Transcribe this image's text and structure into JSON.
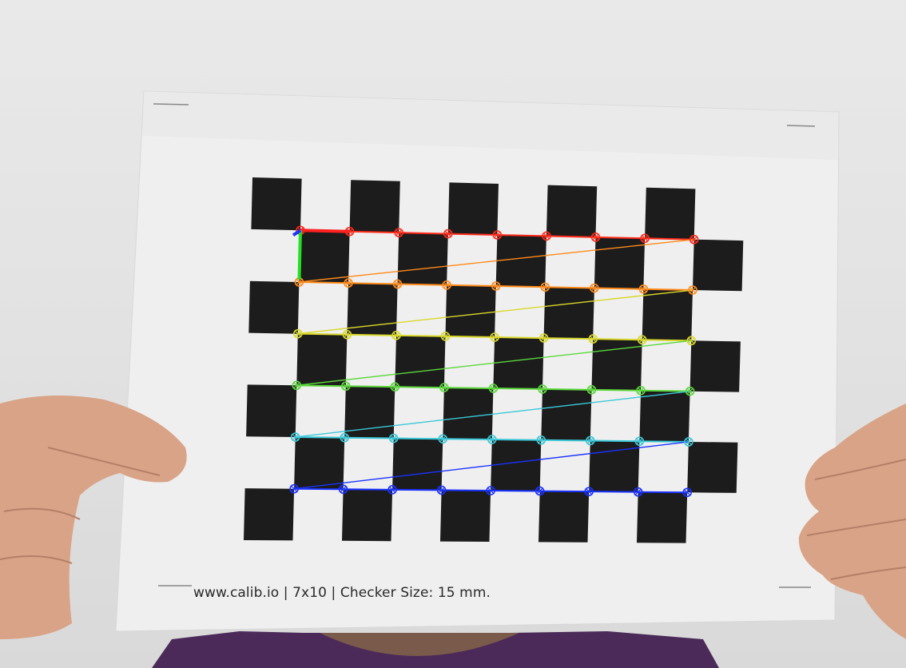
{
  "image": {
    "kind": "photo",
    "subject": "calibration-checkerboard-with-detected-corners"
  },
  "sheet": {
    "caption": "www.calib.io | 7x10 | Checker Size: 15 mm."
  },
  "pattern": {
    "board_rows": 7,
    "board_cols": 10,
    "detected_inner_corners": {
      "cols": 9,
      "rows": 6
    },
    "colors": {
      "paper": "#efefef",
      "square": "#1c1c1c",
      "row_colors": [
        "#ff2a1a",
        "#ff8a1a",
        "#d8d82a",
        "#5ad83a",
        "#3ac8d8",
        "#1a32ff"
      ],
      "x_axis": "#ff2020",
      "y_axis": "#22e022",
      "z_axis": "#2030ff"
    }
  },
  "scene": {
    "skin": "#d9a387",
    "shirt": "#4b2a5a"
  }
}
